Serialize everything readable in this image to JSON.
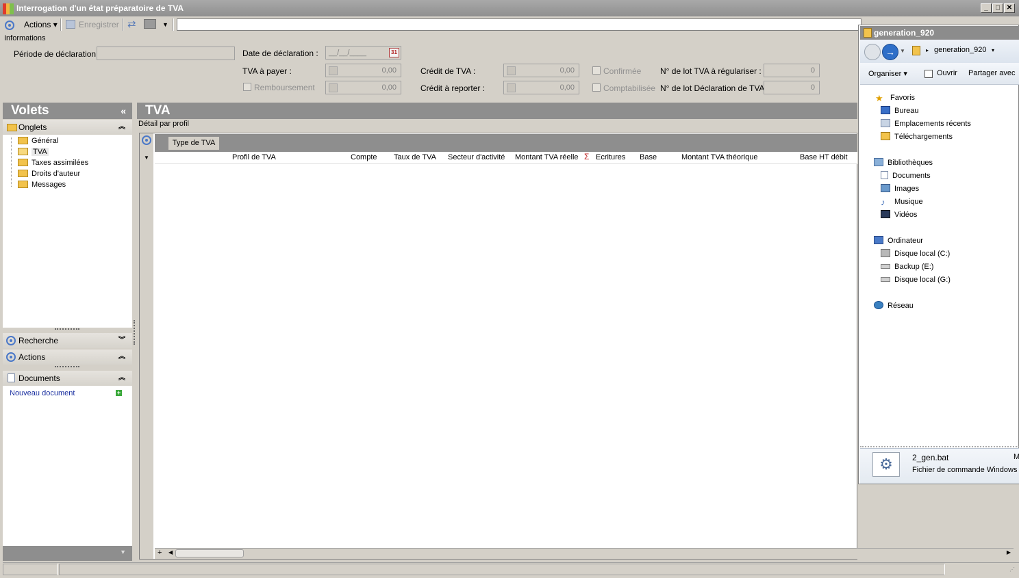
{
  "window": {
    "title": "Interrogation d'un état préparatoire de TVA"
  },
  "toolbar": {
    "actions": "Actions",
    "save": "Enregistrer",
    "search_value": ""
  },
  "info": {
    "section_label": "Informations",
    "periode_label": "Période de déclaration :",
    "date_label": "Date de déclaration :",
    "date_value": "__/__/____",
    "date_calendar": "31",
    "tva_payer_label": "TVA à payer :",
    "tva_payer_value": "0,00",
    "remboursement_label": "Remboursement",
    "remboursement_value": "0,00",
    "credit_tva_label": "Crédit de TVA :",
    "credit_tva_value": "0,00",
    "credit_reporter_label": "Crédit à reporter :",
    "credit_reporter_value": "0,00",
    "confirmee_label": "Confirmée",
    "comptabilisee_label": "Comptabilisée",
    "lot_regulariser_label": "N° de lot TVA à régulariser :",
    "lot_regulariser_value": "0",
    "lot_declaration_label": "N° de lot Déclaration de TVA :",
    "lot_declaration_value": "0"
  },
  "left": {
    "title": "Volets",
    "collapse": "«",
    "onglets": "Onglets",
    "tree": [
      "Général",
      "TVA",
      "Taxes assimilées",
      "Droits d'auteur",
      "Messages"
    ],
    "recherche": "Recherche",
    "actions": "Actions",
    "documents": "Documents",
    "new_doc": "Nouveau document"
  },
  "main": {
    "title": "TVA",
    "subtitle": "Détail par profil",
    "group_button": "Type de TVA",
    "columns": [
      "Profil de TVA",
      "Compte",
      "Taux de TVA",
      "Secteur d'activité",
      "Montant TVA réelle",
      "Ecritures",
      "Base",
      "Montant TVA théorique",
      "Base HT débit"
    ],
    "sum_symbol": "Σ",
    "plus": "+"
  },
  "explorer": {
    "title": "generation_920",
    "breadcrumb": "generation_920",
    "organiser": "Organiser",
    "ouvrir": "Ouvrir",
    "partager": "Partager avec",
    "favoris": "Favoris",
    "favoris_items": [
      "Bureau",
      "Emplacements récents",
      "Téléchargements"
    ],
    "bibliotheques": "Bibliothèques",
    "biblio_items": [
      "Documents",
      "Images",
      "Musique",
      "Vidéos"
    ],
    "ordinateur": "Ordinateur",
    "drives": [
      "Disque local (C:)",
      "Backup (E:)",
      "Disque local (G:)"
    ],
    "reseau": "Réseau",
    "file_name": "2_gen.bat",
    "file_type": "Fichier de commande Windows",
    "file_extra": "M"
  }
}
